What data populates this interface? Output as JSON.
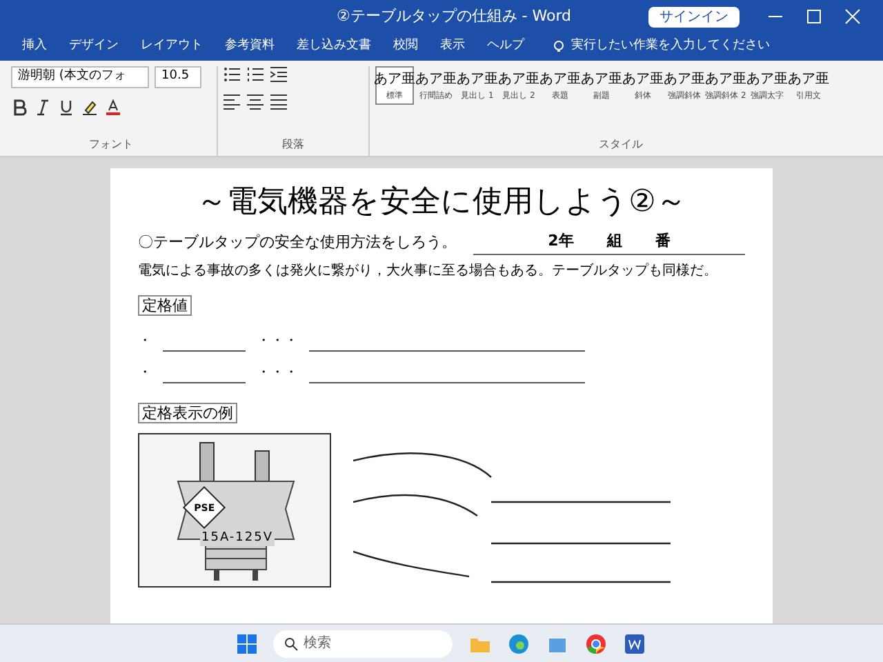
{
  "window": {
    "title": "②テーブルタップの仕組み - Word",
    "sign_in": "サインイン"
  },
  "ribbon_tabs": [
    {
      "label": "挿入",
      "selected": false
    },
    {
      "label": "デザイン",
      "selected": false
    },
    {
      "label": "レイアウト",
      "selected": false
    },
    {
      "label": "参考資料",
      "selected": false
    },
    {
      "label": "差し込み文書",
      "selected": false
    },
    {
      "label": "校閲",
      "selected": false
    },
    {
      "label": "表示",
      "selected": false
    },
    {
      "label": "ヘルプ",
      "selected": false
    }
  ],
  "tell_me": "実行したい作業を入力してください",
  "font": {
    "name": "游明朝 (本文のフォ",
    "size": "10.5"
  },
  "group_labels": [
    "フォント",
    "段落",
    "スタイル"
  ],
  "styles": [
    {
      "sample": "あア亜",
      "name": "標準",
      "selected": true
    },
    {
      "sample": "あア亜",
      "name": "行間詰め",
      "selected": false
    },
    {
      "sample": "あア亜",
      "name": "見出し 1",
      "selected": false
    },
    {
      "sample": "あア亜",
      "name": "見出し 2",
      "selected": false
    },
    {
      "sample": "あア亜",
      "name": "表題",
      "selected": false
    },
    {
      "sample": "あア亜",
      "name": "副題",
      "selected": false
    },
    {
      "sample": "あア亜",
      "name": "斜体",
      "selected": false
    },
    {
      "sample": "あア亜",
      "name": "強調斜体",
      "selected": false
    },
    {
      "sample": "あア亜",
      "name": "強調斜体 2",
      "selected": false
    },
    {
      "sample": "あア亜",
      "name": "強調太字",
      "selected": false
    },
    {
      "sample": "あア亜",
      "name": "引用文",
      "selected": false
    }
  ],
  "document": {
    "title": "～電気機器を安全に使用しよう②～",
    "subtitle": "〇テーブルタップの安全な使用方法をしろう。",
    "class_line": [
      "2年",
      "組",
      "番"
    ],
    "intro": "電気による事故の多くは発火に繋がり，大火事に至る場合もある。テーブルタップも同様だ。",
    "heading_1": "定格値",
    "bullet_items": [
      {
        "marker": "・",
        "separator": "・・・"
      },
      {
        "marker": "・",
        "separator": "・・・"
      }
    ],
    "heading_2": "定格表示の例",
    "plug": {
      "mark": "PSE",
      "rating": "15A-125V"
    }
  },
  "taskbar": {
    "search_placeholder": "検索"
  }
}
